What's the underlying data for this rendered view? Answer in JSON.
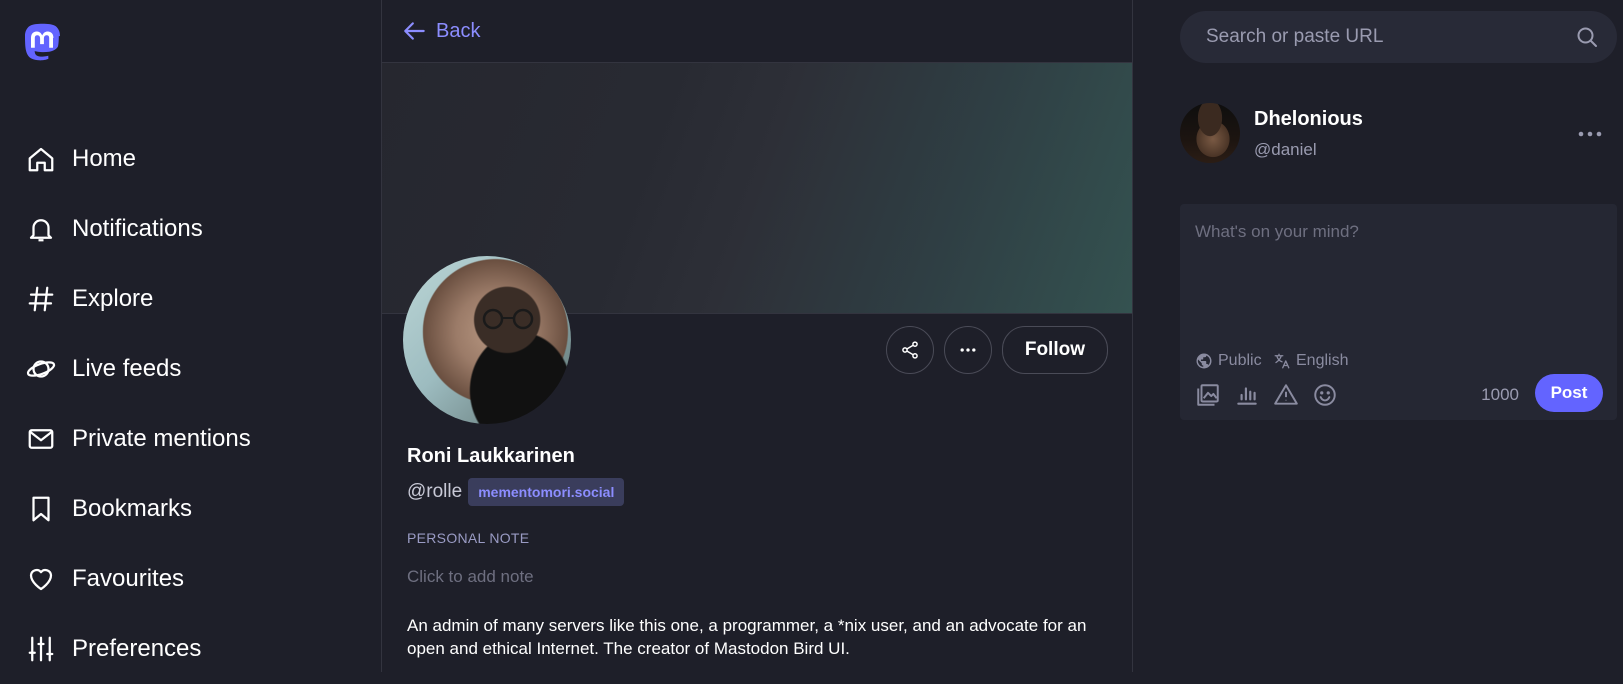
{
  "nav": {
    "items": [
      {
        "label": "Home",
        "icon": "home-icon"
      },
      {
        "label": "Notifications",
        "icon": "bell-icon"
      },
      {
        "label": "Explore",
        "icon": "hashtag-icon"
      },
      {
        "label": "Live feeds",
        "icon": "planet-icon"
      },
      {
        "label": "Private mentions",
        "icon": "envelope-icon"
      },
      {
        "label": "Bookmarks",
        "icon": "bookmark-icon"
      },
      {
        "label": "Favourites",
        "icon": "heart-icon"
      },
      {
        "label": "Preferences",
        "icon": "sliders-icon"
      }
    ]
  },
  "profile": {
    "back_label": "Back",
    "display_name": "Roni Laukkarinen",
    "handle": "@rolle",
    "domain": "mementomori.social",
    "follow_label": "Follow",
    "note_label": "PERSONAL NOTE",
    "note_placeholder": "Click to add note",
    "bio": "An admin of many servers like this one, a programmer, a *nix user, and an advocate for an open and ethical Internet. The creator of Mastodon Bird UI."
  },
  "search": {
    "placeholder": "Search or paste URL"
  },
  "account": {
    "name": "Dhelonious",
    "handle": "@daniel"
  },
  "compose": {
    "placeholder": "What's on your mind?",
    "visibility": "Public",
    "language": "English",
    "char_count": "1000",
    "post_label": "Post"
  },
  "colors": {
    "accent": "#6364ff",
    "link": "#8c8dff",
    "background": "#1e1f29"
  }
}
